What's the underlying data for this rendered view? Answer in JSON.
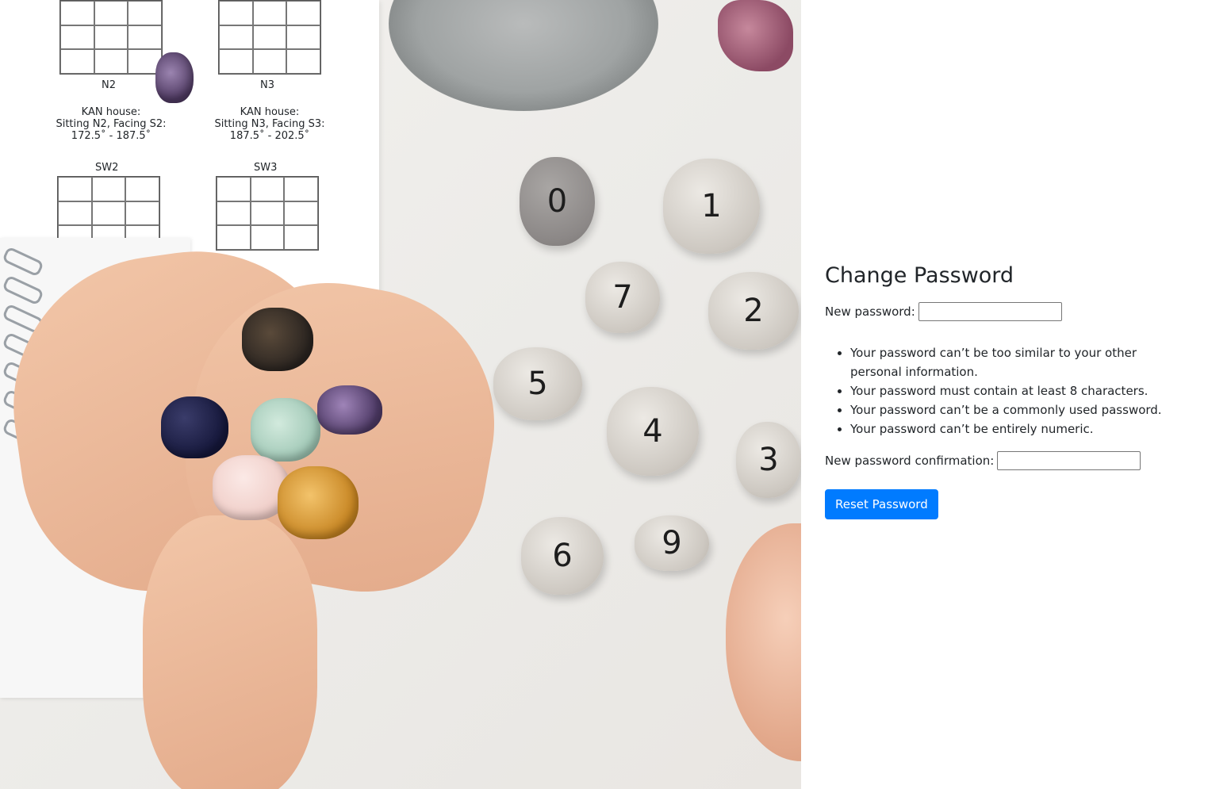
{
  "hero": {
    "stones": [
      {
        "label": "0"
      },
      {
        "label": "1"
      },
      {
        "label": "7"
      },
      {
        "label": "2"
      },
      {
        "label": "5"
      },
      {
        "label": "4"
      },
      {
        "label": "3"
      },
      {
        "label": "6"
      },
      {
        "label": "9"
      }
    ],
    "chart_text": {
      "n2_caption_1": "KAN house:",
      "n2_caption_2": "Sitting N2, Facing S2:",
      "n2_caption_3": "172.5˚ - 187.5˚",
      "n3_caption_1": "KAN house:",
      "n3_caption_2": "Sitting N3, Facing S3:",
      "n3_caption_3": "187.5˚ - 202.5˚",
      "n2_label": "N2",
      "n3_label": "N3",
      "sw2_label": "SW2",
      "sw3_label": "SW3"
    }
  },
  "form": {
    "title": "Change Password",
    "new_password_label": "New password:",
    "new_password_value": "",
    "help_items": [
      "Your password can’t be too similar to your other personal information.",
      "Your password must contain at least 8 characters.",
      "Your password can’t be a commonly used password.",
      "Your password can’t be entirely numeric."
    ],
    "confirm_label": "New password confirmation:",
    "confirm_value": "",
    "submit_label": "Reset Password"
  },
  "colors": {
    "primary": "#007bff",
    "text": "#212529"
  }
}
